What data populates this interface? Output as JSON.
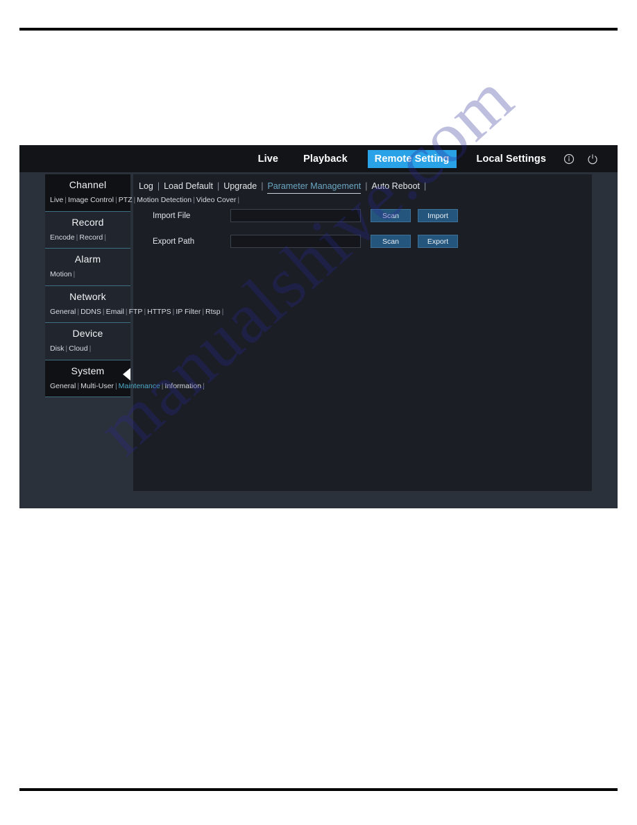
{
  "watermark": {
    "text": "manualshive.com"
  },
  "header": {
    "nav": [
      {
        "label": "Live",
        "active": false
      },
      {
        "label": "Playback",
        "active": false
      },
      {
        "label": "Remote Setting",
        "active": true
      },
      {
        "label": "Local Settings",
        "active": false
      }
    ],
    "icons": [
      {
        "name": "info-icon"
      },
      {
        "name": "power-icon"
      }
    ],
    "accent_color": "#29a2e8"
  },
  "sidebar": {
    "groups": [
      {
        "title": "Channel",
        "expanded": true,
        "arrow": false,
        "subs": [
          {
            "label": "Live",
            "active": false
          },
          {
            "label": "Image Control",
            "active": false
          },
          {
            "label": "PTZ",
            "active": false
          },
          {
            "label": "Motion Detection",
            "active": false
          },
          {
            "label": "Video Cover",
            "active": false
          }
        ]
      },
      {
        "title": "Record",
        "expanded": false,
        "arrow": false,
        "subs": [
          {
            "label": "Encode",
            "active": false
          },
          {
            "label": "Record",
            "active": false
          }
        ]
      },
      {
        "title": "Alarm",
        "expanded": false,
        "arrow": false,
        "subs": [
          {
            "label": "Motion",
            "active": false
          }
        ]
      },
      {
        "title": "Network",
        "expanded": false,
        "arrow": false,
        "subs": [
          {
            "label": "General",
            "active": false
          },
          {
            "label": "DDNS",
            "active": false
          },
          {
            "label": "Email",
            "active": false
          },
          {
            "label": "FTP",
            "active": false
          },
          {
            "label": "HTTPS",
            "active": false
          },
          {
            "label": "IP Filter",
            "active": false
          },
          {
            "label": "Rtsp",
            "active": false
          }
        ]
      },
      {
        "title": "Device",
        "expanded": false,
        "arrow": false,
        "subs": [
          {
            "label": "Disk",
            "active": false
          },
          {
            "label": "Cloud",
            "active": false
          }
        ]
      },
      {
        "title": "System",
        "expanded": true,
        "arrow": true,
        "subs": [
          {
            "label": "General",
            "active": false
          },
          {
            "label": "Multi-User",
            "active": false
          },
          {
            "label": "Maintenance",
            "active": true
          },
          {
            "label": "Information",
            "active": false
          }
        ]
      }
    ]
  },
  "content": {
    "tabs": [
      {
        "label": "Log",
        "active": false
      },
      {
        "label": "Load Default",
        "active": false
      },
      {
        "label": "Upgrade",
        "active": false
      },
      {
        "label": "Parameter Management",
        "active": true
      },
      {
        "label": "Auto Reboot",
        "active": false
      }
    ],
    "rows": [
      {
        "label": "Import File",
        "value": "",
        "placeholder": "",
        "buttons": [
          {
            "label": "Scan",
            "name": "scan-import-button"
          },
          {
            "label": "Import",
            "name": "import-button"
          }
        ]
      },
      {
        "label": "Export Path",
        "value": "",
        "placeholder": "",
        "buttons": [
          {
            "label": "Scan",
            "name": "scan-export-button"
          },
          {
            "label": "Export",
            "name": "export-button"
          }
        ]
      }
    ]
  }
}
